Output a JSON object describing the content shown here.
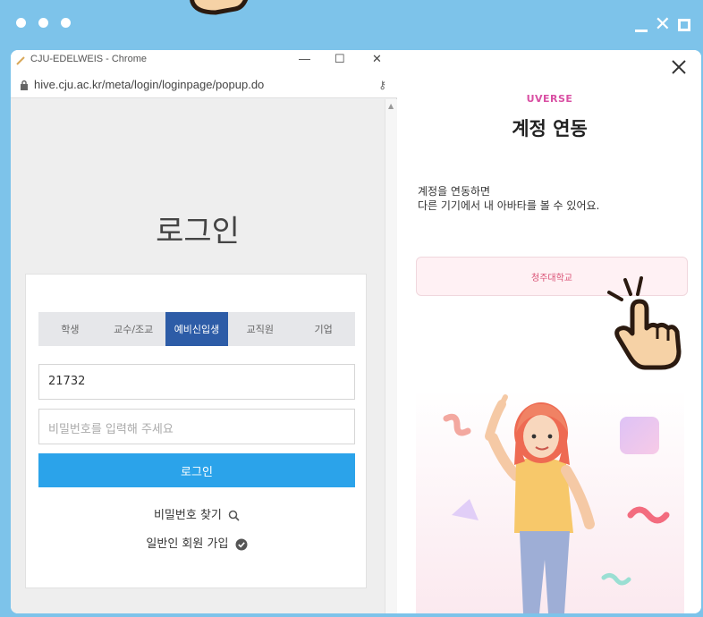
{
  "chrome": {
    "title": "CJU-EDELWEIS - Chrome",
    "url": "hive.cju.ac.kr/meta/login/loginpage/popup.do",
    "min": "—",
    "max": "☐",
    "close": "✕"
  },
  "login": {
    "title": "로그인",
    "tabs": [
      "학생",
      "교수/조교",
      "예비신입생",
      "교직원",
      "기업"
    ],
    "active_tab": "예비신입생",
    "id_value": "21732",
    "password_placeholder": "비밀번호를 입력해 주세요",
    "login_button": "로그인",
    "find_password": "비밀번호 찾기",
    "join": "일반인 회원 가입"
  },
  "panel": {
    "brand": "UVERSE",
    "title": "계정 연동",
    "desc_line1": "계정을 연동하면",
    "desc_line2": "다른 기기에서 내 아바타를 볼 수 있어요.",
    "university_button": "청주대학교"
  },
  "colors": {
    "frame": "#7dc3ea",
    "active_tab": "#2d5ca7",
    "login_button": "#2ba3ea",
    "brand": "#d94fa3",
    "univ_button_bg": "#fff1f4"
  }
}
